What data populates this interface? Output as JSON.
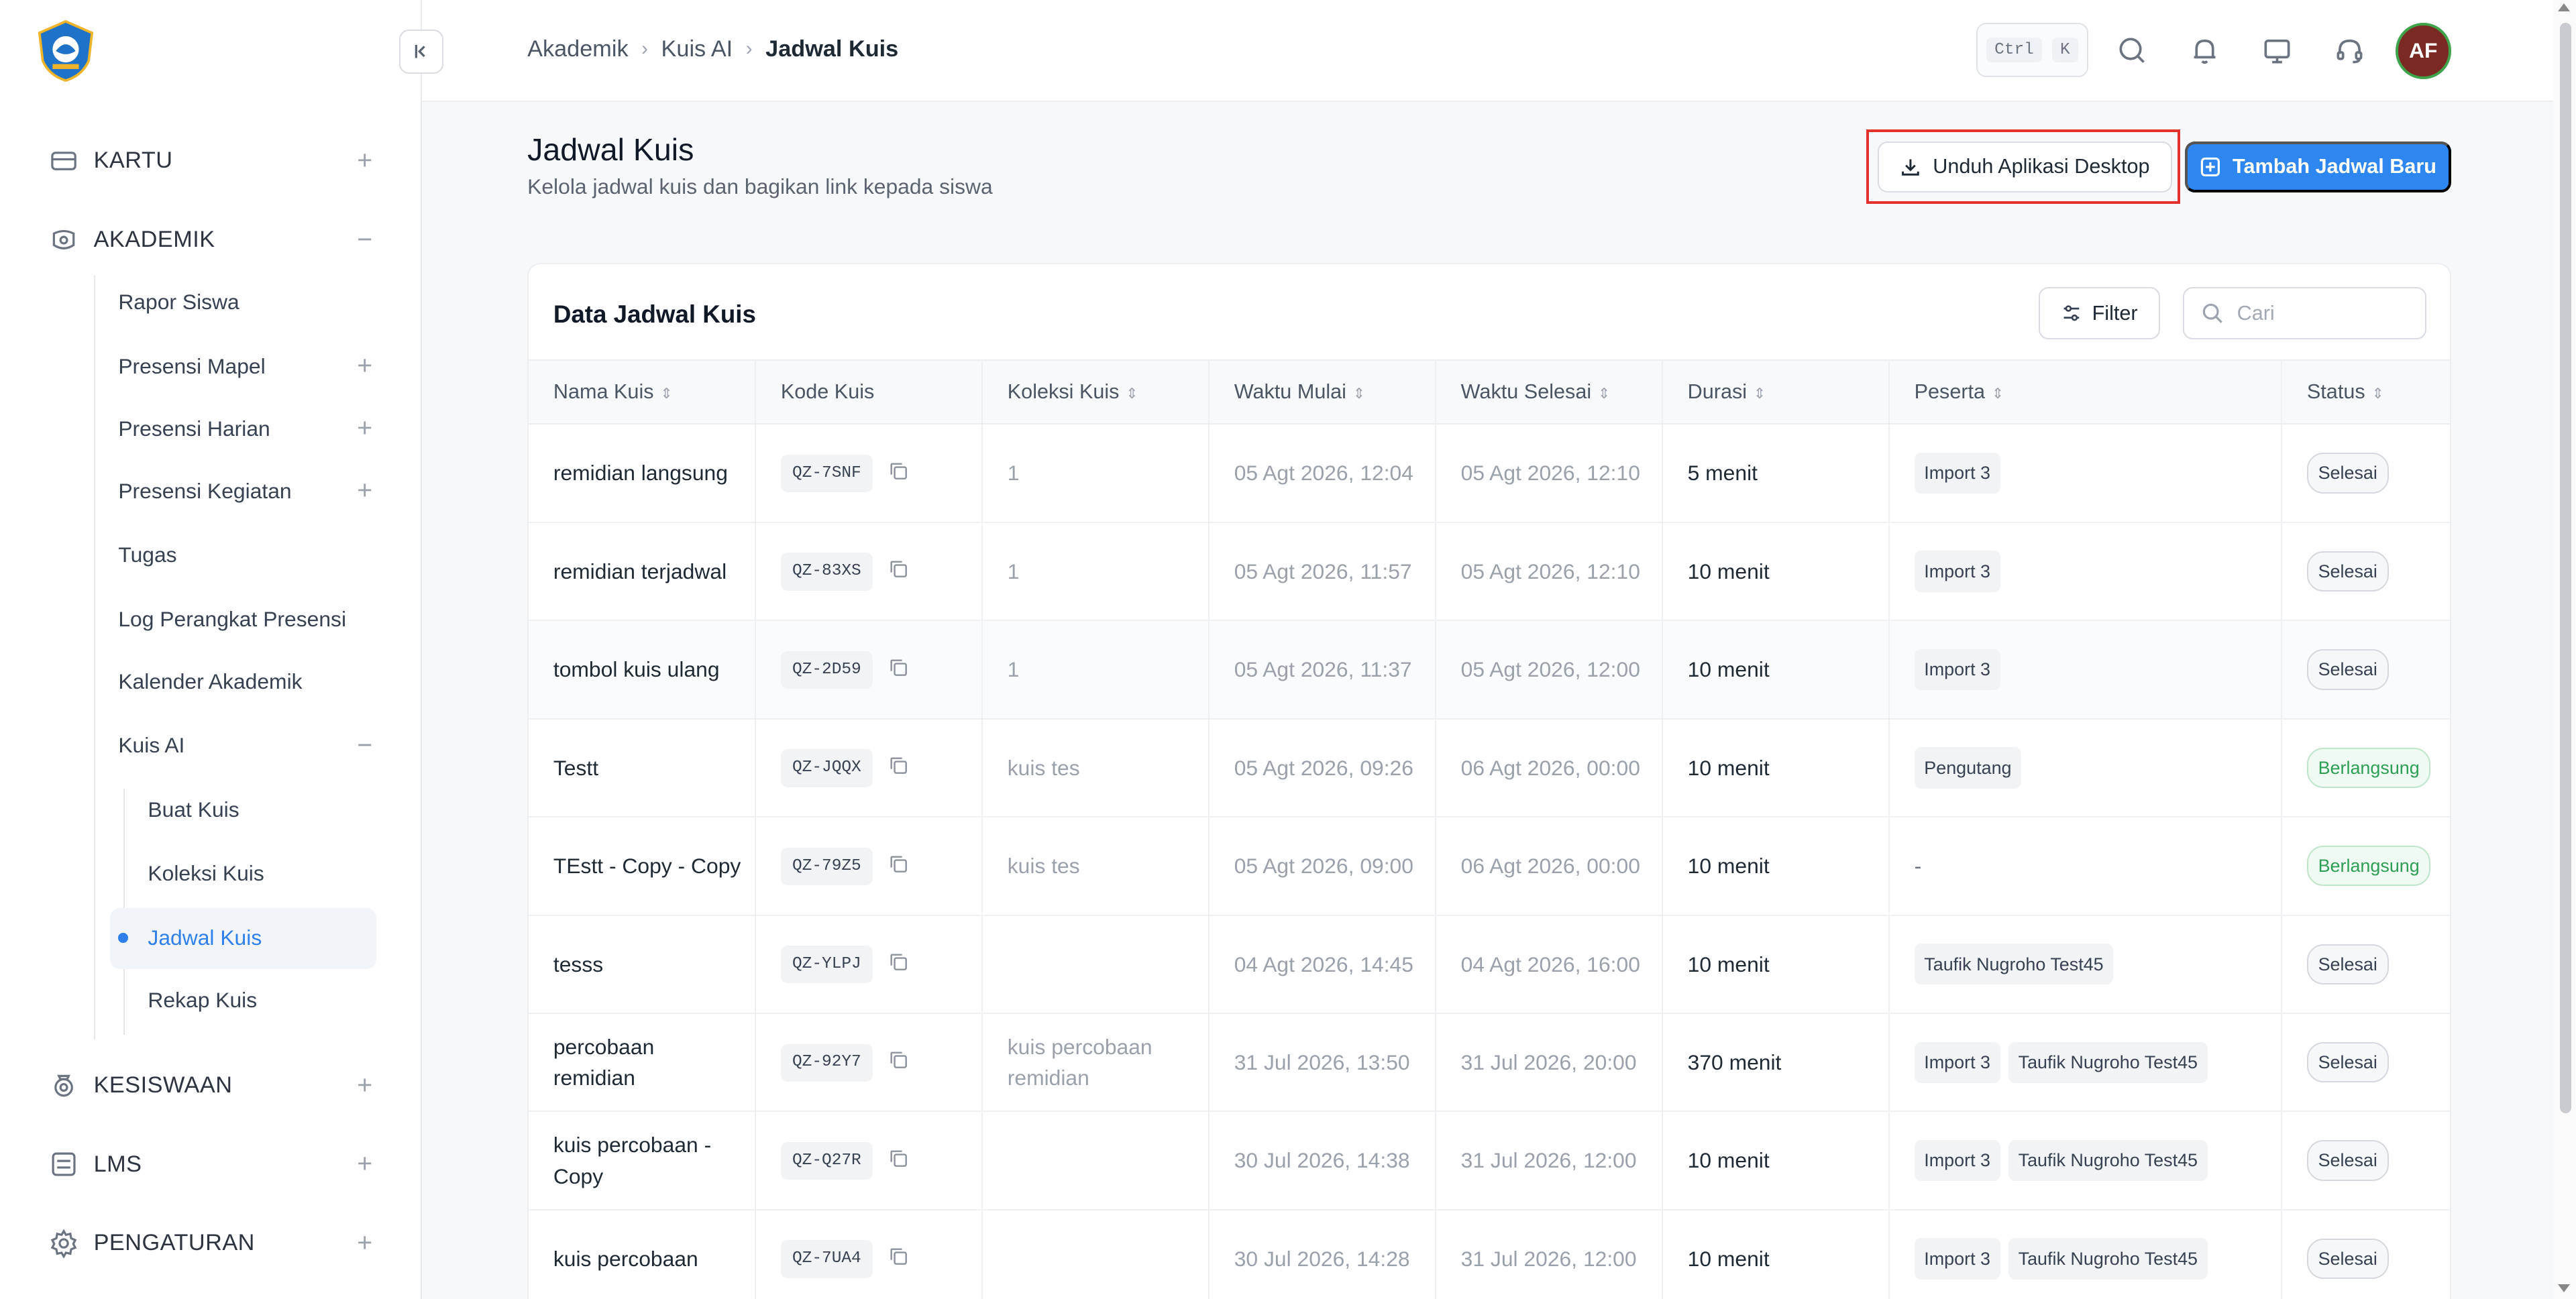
{
  "app": {
    "avatar_initials": "AF",
    "accent": "#2e86f0"
  },
  "sidebar": {
    "sections": [
      {
        "label": "KARTU",
        "toggle": "+",
        "icon": "card-icon"
      },
      {
        "label": "AKADEMIK",
        "toggle": "−",
        "icon": "academic-icon"
      },
      {
        "label": "KESISWAAN",
        "toggle": "+",
        "icon": "student-icon"
      },
      {
        "label": "LMS",
        "toggle": "+",
        "icon": "lms-icon"
      },
      {
        "label": "PENGATURAN",
        "toggle": "+",
        "icon": "settings-gear-icon"
      }
    ],
    "akademik_items": [
      {
        "label": "Rapor Siswa",
        "toggle": ""
      },
      {
        "label": "Presensi Mapel",
        "toggle": "+"
      },
      {
        "label": "Presensi Harian",
        "toggle": "+"
      },
      {
        "label": "Presensi Kegiatan",
        "toggle": "+"
      },
      {
        "label": "Tugas",
        "toggle": ""
      },
      {
        "label": "Log Perangkat Presensi",
        "toggle": ""
      },
      {
        "label": "Kalender Akademik",
        "toggle": ""
      },
      {
        "label": "Kuis AI",
        "toggle": "−"
      }
    ],
    "kuis_items": [
      {
        "label": "Buat Kuis"
      },
      {
        "label": "Koleksi Kuis"
      },
      {
        "label": "Jadwal Kuis"
      },
      {
        "label": "Rekap Kuis"
      }
    ]
  },
  "topbar": {
    "breadcrumb": [
      "Akademik",
      "Kuis AI",
      "Jadwal Kuis"
    ],
    "shortcut": [
      "Ctrl",
      "K"
    ]
  },
  "page": {
    "title": "Jadwal Kuis",
    "subtitle": "Kelola jadwal kuis dan bagikan link kepada siswa",
    "download_btn": "Unduh Aplikasi Desktop",
    "add_btn": "Tambah Jadwal Baru"
  },
  "table": {
    "title": "Data Jadwal Kuis",
    "filter_label": "Filter",
    "search_placeholder": "Cari",
    "columns": [
      "Nama Kuis",
      "Kode Kuis",
      "Koleksi Kuis",
      "Waktu Mulai",
      "Waktu Selesai",
      "Durasi",
      "Peserta",
      "Status"
    ],
    "rows": [
      {
        "name": "remidian langsung",
        "code": "QZ-7SNF",
        "collection": "1",
        "start": "05 Agt 2026, 12:04",
        "end": "05 Agt 2026, 12:10",
        "duration": "5 menit",
        "participants": [
          "Import 3"
        ],
        "status": "Selesai"
      },
      {
        "name": "remidian terjadwal",
        "code": "QZ-83XS",
        "collection": "1",
        "start": "05 Agt 2026, 11:57",
        "end": "05 Agt 2026, 12:10",
        "duration": "10 menit",
        "participants": [
          "Import 3"
        ],
        "status": "Selesai"
      },
      {
        "name": "tombol kuis ulang",
        "code": "QZ-2D59",
        "collection": "1",
        "start": "05 Agt 2026, 11:37",
        "end": "05 Agt 2026, 12:00",
        "duration": "10 menit",
        "participants": [
          "Import 3"
        ],
        "status": "Selesai"
      },
      {
        "name": "Testt",
        "code": "QZ-JQQX",
        "collection": "kuis tes",
        "start": "05 Agt 2026, 09:26",
        "end": "06 Agt 2026, 00:00",
        "duration": "10 menit",
        "participants": [
          "Pengutang"
        ],
        "status": "Berlangsung"
      },
      {
        "name": "TEstt - Copy - Copy",
        "code": "QZ-79Z5",
        "collection": "kuis tes",
        "start": "05 Agt 2026, 09:00",
        "end": "06 Agt 2026, 00:00",
        "duration": "10 menit",
        "participants": [],
        "participants_empty": "-",
        "status": "Berlangsung"
      },
      {
        "name": "tesss",
        "code": "QZ-YLPJ",
        "collection": "",
        "start": "04 Agt 2026, 14:45",
        "end": "04 Agt 2026, 16:00",
        "duration": "10 menit",
        "participants": [
          "Taufik Nugroho Test45"
        ],
        "status": "Selesai"
      },
      {
        "name": "percobaan remidian",
        "code": "QZ-92Y7",
        "collection": "kuis percobaan remidian",
        "start": "31 Jul 2026, 13:50",
        "end": "31 Jul 2026, 20:00",
        "duration": "370 menit",
        "participants": [
          "Import 3",
          "Taufik Nugroho Test45"
        ],
        "status": "Selesai"
      },
      {
        "name": "kuis percobaan - Copy",
        "code": "QZ-Q27R",
        "collection": "",
        "start": "30 Jul 2026, 14:38",
        "end": "31 Jul 2026, 12:00",
        "duration": "10 menit",
        "participants": [
          "Import 3",
          "Taufik Nugroho Test45"
        ],
        "status": "Selesai"
      },
      {
        "name": "kuis percobaan",
        "code": "QZ-7UA4",
        "collection": "",
        "start": "30 Jul 2026, 14:28",
        "end": "31 Jul 2026, 12:00",
        "duration": "10 menit",
        "participants": [
          "Import 3",
          "Taufik Nugroho Test45"
        ],
        "status": "Selesai"
      }
    ]
  }
}
